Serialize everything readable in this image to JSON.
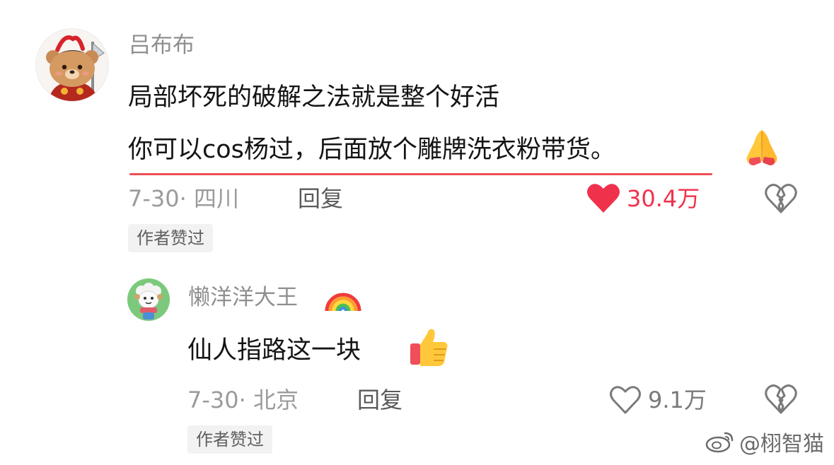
{
  "comments": [
    {
      "username": "吕布布",
      "lines": [
        "局部坏死的破解之法就是整个好活",
        "你可以cos杨过，后面放个雕牌洗衣粉带货。"
      ],
      "line2_emoji": "folded-hands-emoji",
      "meta": "7-30· 四川",
      "reply_label": "回复",
      "likes": "30.4万",
      "liked": true,
      "badge": "作者赞过",
      "like_color": "#f0314c",
      "underline_color": "#ee4f55"
    },
    {
      "username": "懒洋洋大王",
      "username_emoji": "rainbow-emoji",
      "text": "仙人指路这一块",
      "text_emoji": "thumbs-up-emoji",
      "meta": "7-30· 北京",
      "reply_label": "回复",
      "likes": "9.1万",
      "liked": false,
      "badge": "作者赞过"
    }
  ],
  "watermark": {
    "prefix": "@",
    "name": "栩智猫",
    "icon": "weibo-logo-icon"
  }
}
